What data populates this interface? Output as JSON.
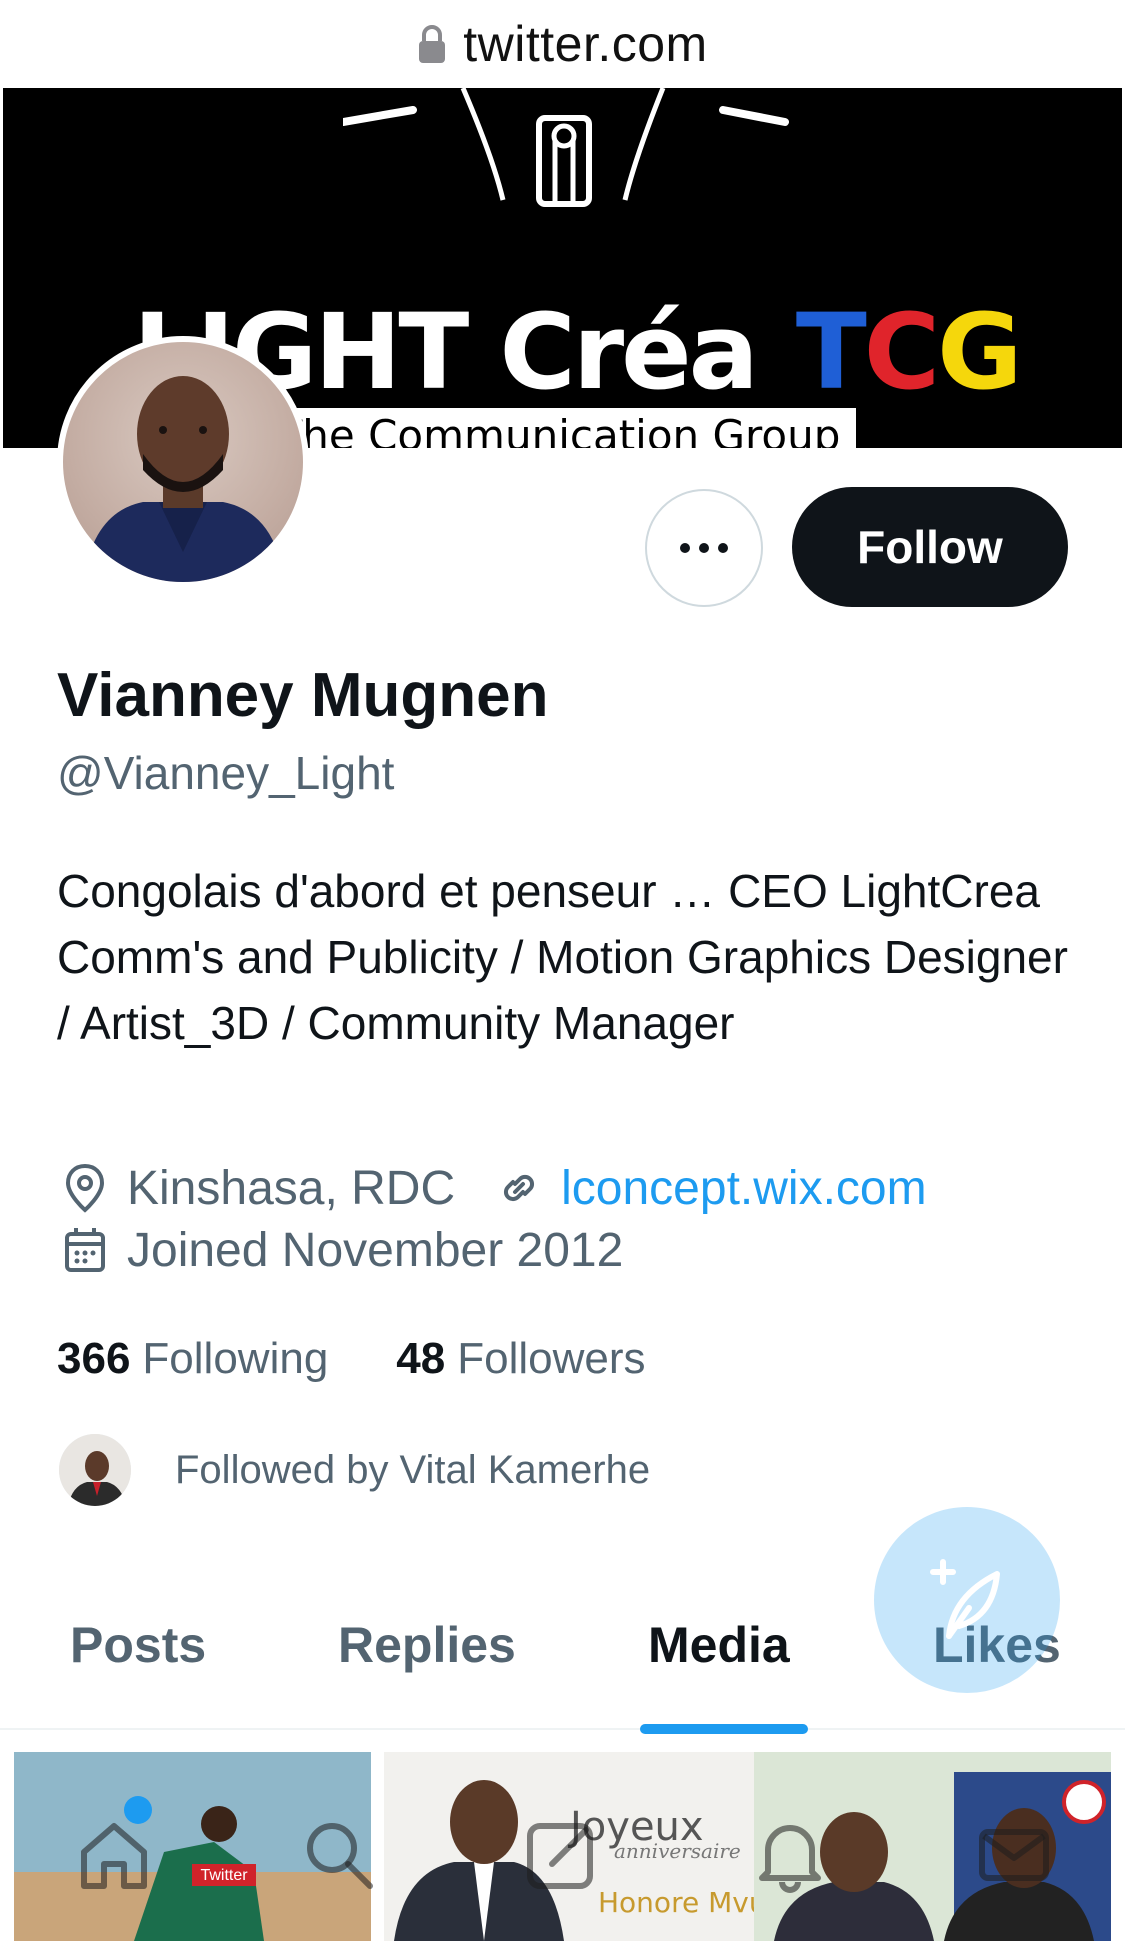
{
  "browser": {
    "domain": "twitter.com",
    "lock_icon": "lock-icon"
  },
  "banner": {
    "logo_light": "LIGHT Créa",
    "logo_tcg": {
      "t": "T",
      "c": "C",
      "g": "G"
    },
    "tagline": "The Communication Group",
    "colors": {
      "background": "#000000",
      "t": "#1f5fd6",
      "c": "#e0242b",
      "g": "#f5d70c"
    }
  },
  "profile": {
    "name": "Vianney Mugnen",
    "handle": "@Vianney_Light",
    "bio": "Congolais d'abord et penseur … CEO LightCrea Comm's and Publicity / Motion Graphics Designer / Artist_3D / Community Manager",
    "location": "Kinshasa, RDC",
    "website": "lconcept.wix.com",
    "joined": "Joined November 2012",
    "following_count": "366",
    "following_label": "Following",
    "followers_count": "48",
    "followers_label": "Followers",
    "followed_by": "Followed by Vital Kamerhe"
  },
  "actions": {
    "follow_label": "Follow",
    "more_icon": "more-icon"
  },
  "tabs": [
    {
      "label": "Posts",
      "active": false
    },
    {
      "label": "Replies",
      "active": false
    },
    {
      "label": "Media",
      "active": true
    },
    {
      "label": "Likes",
      "active": false
    }
  ],
  "media": {
    "thumb1_label": "Twitter",
    "thumb2_title": "Joyeux",
    "thumb2_subtitle": "anniversaire",
    "thumb2_name": "Honore Mvula"
  },
  "colors": {
    "accent": "#1d9bf0",
    "text": "#0f1419",
    "secondary": "#536471"
  },
  "bottom_nav": [
    "home-icon",
    "search-icon",
    "compose-icon",
    "bell-icon",
    "mail-icon"
  ]
}
